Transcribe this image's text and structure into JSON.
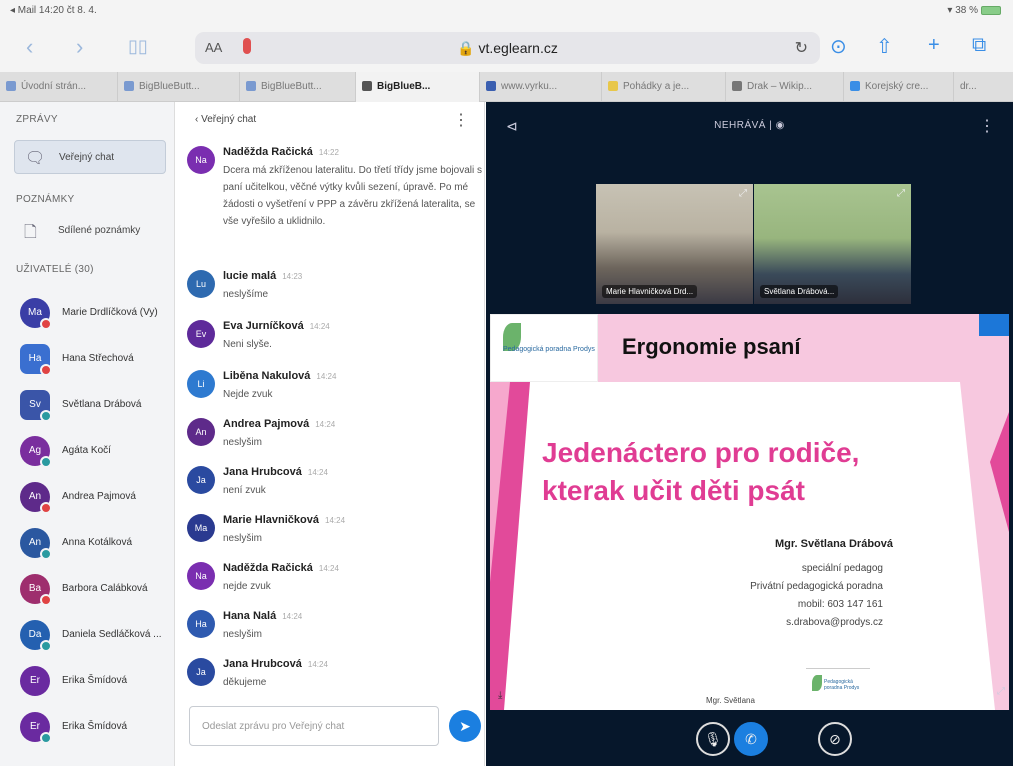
{
  "statusbar": {
    "left": "◂ Mail  14:20  čt 8. 4.",
    "right": "▾ 38 %"
  },
  "browser": {
    "url": "vt.eglearn.cz",
    "aa": "AA",
    "tabs": [
      {
        "label": "Úvodní strán..."
      },
      {
        "label": "BigBlueButt..."
      },
      {
        "label": "BigBlueButt..."
      },
      {
        "label": "BigBlueB..."
      },
      {
        "label": "www.vyrku..."
      },
      {
        "label": "Pohádky a je..."
      },
      {
        "label": "Drak – Wikip..."
      },
      {
        "label": "Korejský cre..."
      },
      {
        "label": "dr..."
      }
    ]
  },
  "sidebar": {
    "messages_title": "ZPRÁVY",
    "public_chat": "Veřejný chat",
    "notes_title": "POZNÁMKY",
    "shared_notes": "Sdílené poznámky",
    "users_title": "UŽIVATELÉ (30)",
    "users": [
      {
        "initials": "Ma",
        "name": "Marie Drdlíčková (Vy)",
        "color": "#3a3ea6",
        "dot": "#e04343",
        "shape": "circle"
      },
      {
        "initials": "Ha",
        "name": "Hana Střechová",
        "color": "#3a6fd0",
        "dot": "#e04343",
        "shape": "square"
      },
      {
        "initials": "Sv",
        "name": "Světlana Drábová",
        "color": "#3a55a8",
        "dot": "#2a9aa0",
        "shape": "square"
      },
      {
        "initials": "Ag",
        "name": "Agáta Kočí",
        "color": "#7a2e9e",
        "dot": "#2a9aa0",
        "shape": "circle"
      },
      {
        "initials": "An",
        "name": "Andrea Pajmová",
        "color": "#5e2a8a",
        "dot": "#e04343",
        "shape": "circle"
      },
      {
        "initials": "An",
        "name": "Anna Kotálková",
        "color": "#2b58a0",
        "dot": "#2a9aa0",
        "shape": "circle"
      },
      {
        "initials": "Ba",
        "name": "Barbora Calábková",
        "color": "#9e2e6e",
        "dot": "#e04343",
        "shape": "circle"
      },
      {
        "initials": "Da",
        "name": "Daniela Sedláčková ...",
        "color": "#2460b0",
        "dot": "#2a9aa0",
        "shape": "circle"
      },
      {
        "initials": "Er",
        "name": "Erika Šmídová",
        "color": "#6a2aa0",
        "dot": "",
        "shape": "circle"
      },
      {
        "initials": "Er",
        "name": "Erika Šmídová",
        "color": "#6a2aa0",
        "dot": "#2a9aa0",
        "shape": "circle"
      }
    ]
  },
  "chat": {
    "title": "‹ Veřejný chat",
    "input_placeholder": "Odeslat zprávu pro Veřejný chat",
    "messages": [
      {
        "initials": "Na",
        "name": "Naděžda Račická",
        "time": "14:22",
        "color": "#7a2eb0",
        "text": "Dcera má zkříženou lateralitu. Do třetí třídy jsme bojovali s paní učitelkou, věčné výtky kvůli sezení, úpravě. Po mé žádosti o vyšetření v PPP a závěru zkřížená lateralita, se vše vyřešilo a uklidnilo."
      },
      {
        "initials": "Lu",
        "name": "lucie malá",
        "time": "14:23",
        "color": "#2e6ab0",
        "text": "neslyšíme"
      },
      {
        "initials": "Ev",
        "name": "Eva Jurníčková",
        "time": "14:24",
        "color": "#5e2a9a",
        "text": "Neni slyše."
      },
      {
        "initials": "Li",
        "name": "Liběna Nakulová",
        "time": "14:24",
        "color": "#2e7ad0",
        "text": "Nejde zvuk"
      },
      {
        "initials": "An",
        "name": "Andrea Pajmová",
        "time": "14:24",
        "color": "#5e2a8a",
        "text": "neslyšim"
      },
      {
        "initials": "Ja",
        "name": "Jana Hrubcová",
        "time": "14:24",
        "color": "#2a4aa0",
        "text": "není zvuk"
      },
      {
        "initials": "Ma",
        "name": "Marie Hlavničková",
        "time": "14:24",
        "color": "#2a3a90",
        "text": "neslyšim"
      },
      {
        "initials": "Na",
        "name": "Naděžda Račická",
        "time": "14:24",
        "color": "#7a2eb0",
        "text": "nejde zvuk"
      },
      {
        "initials": "Ha",
        "name": "Hana Nalá",
        "time": "14:24",
        "color": "#2e5ab0",
        "text": "neslyšim"
      },
      {
        "initials": "Ja",
        "name": "Jana Hrubcová",
        "time": "14:24",
        "color": "#2a4aa0",
        "text": "děkujeme"
      }
    ]
  },
  "stage": {
    "recording": "NEHRÁVÁ  |  ◉",
    "videos": [
      {
        "name": "Marie Hlavničková Drd..."
      },
      {
        "name": "Světlana Drábová..."
      }
    ],
    "slide": {
      "logo_text": "Pedagogická poradna Prodys",
      "title": "Ergonomie psaní",
      "main_title_line1": "Jedenáctero pro rodiče,",
      "main_title_line2": "kterak učit děti psát",
      "author": "Mgr. Světlana Drábová",
      "info": [
        "speciální pedagog",
        "Privátní pedagogická poradna",
        "mobil: 603 147 161",
        "s.drabova@prodys.cz"
      ],
      "bottom_name": "Mgr. Světlana",
      "small_logo_text": "Pedagogická poradna Prodys"
    }
  }
}
